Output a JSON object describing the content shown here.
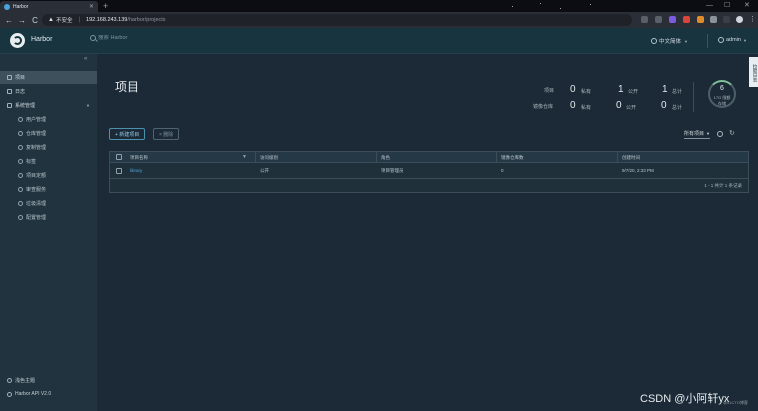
{
  "browser": {
    "tab_title": "Harbor",
    "tab_close": "✕",
    "new_tab": "+",
    "win_minimize": "—",
    "win_maximize": "☐",
    "win_close": "✕",
    "back": "←",
    "forward": "→",
    "reload": "C",
    "insecure_label": "不安全",
    "url_host": "192.168.243.139",
    "url_path": "/harbor/projects"
  },
  "header": {
    "brand": "Harbor",
    "search_placeholder": "搜索 Harbor",
    "language": "中文简体",
    "user": "admin"
  },
  "sidebar": {
    "collapse_icon": "«",
    "items": [
      {
        "label": "项目",
        "icon": "folder-icon"
      },
      {
        "label": "日志",
        "icon": "log-icon"
      },
      {
        "label": "系统管理",
        "icon": "admin-icon"
      }
    ],
    "sub_items": [
      {
        "label": "用户管理",
        "icon": "users-icon"
      },
      {
        "label": "仓库管理",
        "icon": "registry-icon"
      },
      {
        "label": "复制管理",
        "icon": "replication-icon"
      },
      {
        "label": "标签",
        "icon": "tag-icon"
      },
      {
        "label": "项目定额",
        "icon": "quota-icon"
      },
      {
        "label": "审查服务",
        "icon": "scan-icon"
      },
      {
        "label": "垃圾清理",
        "icon": "trash-icon"
      },
      {
        "label": "配置管理",
        "icon": "gear-icon"
      }
    ],
    "footer_theme": "浅色主题",
    "footer_api": "Harbor API V2.0"
  },
  "main": {
    "title": "项目",
    "stats": {
      "project_label": "项目",
      "repo_label": "镜像仓库",
      "private_label": "私有",
      "public_label": "公开",
      "total_label": "总计",
      "project_private": "0",
      "project_public": "1",
      "project_total": "1",
      "repo_private": "0",
      "repo_public": "0",
      "repo_total": "0"
    },
    "quota": {
      "used": "6",
      "limit": "17G 限额",
      "label": "存储"
    },
    "side_tab": "拉取日志",
    "new_button": "+ 新建项目",
    "delete_button": "× 删除",
    "filter": "所有项目",
    "refresh_icon": "↻",
    "table": {
      "columns": [
        "项目名称",
        "访问级别",
        "角色",
        "镜像仓库数",
        "创建时间"
      ],
      "rows": [
        {
          "name": "library",
          "access": "公开",
          "role": "项目管理员",
          "repo_count": "0",
          "created": "9/7/20, 2:33 PM"
        }
      ],
      "footer": "1 - 1 共计 1 条记录"
    }
  },
  "watermark": {
    "text": "CSDN @小阿轩yx",
    "sub": "@51CTO博客"
  }
}
